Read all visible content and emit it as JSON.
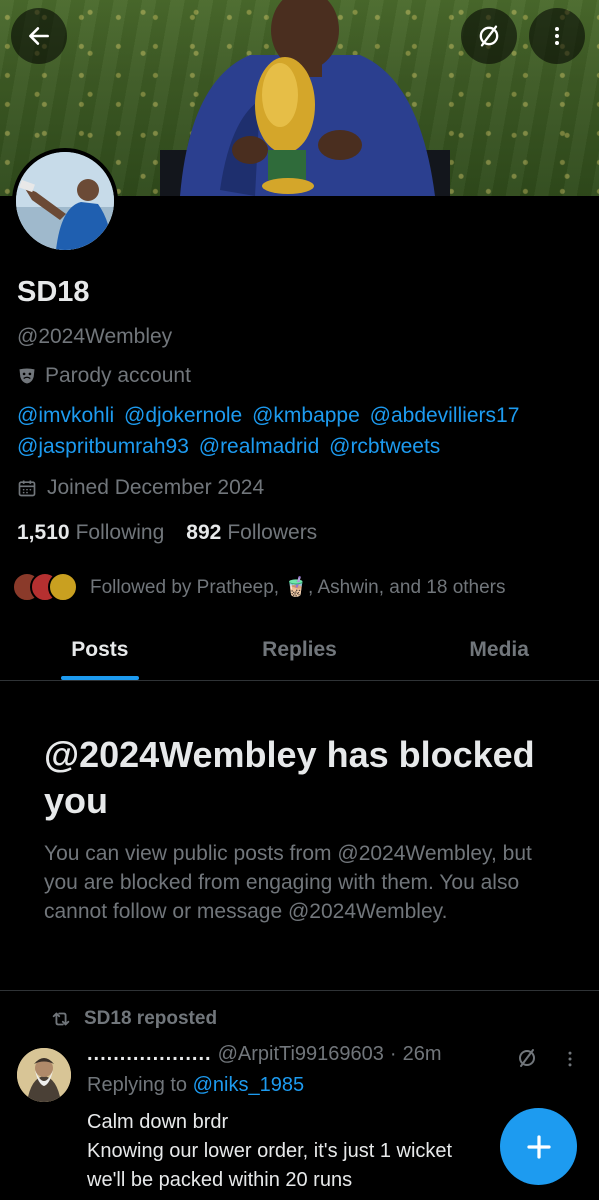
{
  "profile": {
    "name": "SD18",
    "handle": "@2024Wembley",
    "parody_label": "Parody account",
    "bio_mentions": [
      "@imvkohli",
      "@djokernole",
      "@kmbappe",
      "@abdevilliers17",
      "@jaspritbumrah93",
      "@realmadrid",
      "@rcbtweets"
    ],
    "joined": "Joined December 2024",
    "following_count": "1,510",
    "following_label": "Following",
    "followers_count": "892",
    "followers_label": "Followers",
    "followed_by": "Followed by Pratheep, 🧋, Ashwin, and 18 others"
  },
  "tabs": [
    {
      "label": "Posts",
      "active": true
    },
    {
      "label": "Replies",
      "active": false
    },
    {
      "label": "Media",
      "active": false
    }
  ],
  "blocked": {
    "title": "@2024Wembley has blocked you",
    "message": "You can view public posts from @2024Wembley, but you are blocked from engaging with them. You also cannot follow or message @2024Wembley."
  },
  "post": {
    "repost_label": "SD18 reposted",
    "author_name": "...................",
    "author_handle": "@ArpitTi99169603",
    "separator": "·",
    "time": "26m",
    "replying_prefix": "Replying to ",
    "replying_handle": "@niks_1985",
    "text": "Calm down brdr\nKnowing our lower order, it's just 1 wicket\nwe'll be packed within 20 runs"
  },
  "icons": {
    "back": "arrow-left-icon",
    "parody_banner": "slashed-circle-icon",
    "more": "more-vertical-icon",
    "parody": "theater-mask-icon",
    "calendar": "calendar-icon",
    "repost": "repost-icon",
    "compose": "plus-icon"
  },
  "colors": {
    "accent": "#1d9bf0",
    "muted": "#71767b",
    "text": "#e7e9ea",
    "background": "#000000",
    "border": "#2f3336"
  }
}
